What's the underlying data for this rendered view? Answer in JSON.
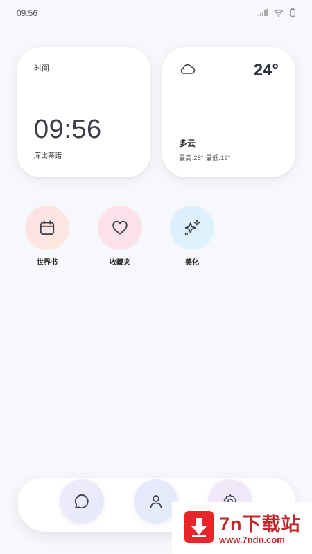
{
  "status_bar": {
    "time": "09:56",
    "icons": [
      "signal-icon",
      "wifi-icon",
      "battery-icon"
    ]
  },
  "time_widget": {
    "label": "时间",
    "time": "09:56",
    "subtitle": "库比蒂诺"
  },
  "weather_widget": {
    "icon": "cloud-icon",
    "temperature": "24°",
    "condition": "多云",
    "range": "最高:28° 最低:19°"
  },
  "apps": [
    {
      "label": "世界书",
      "icon": "calendar-icon",
      "color": "#fde0e6"
    },
    {
      "label": "收藏夹",
      "icon": "heart-icon",
      "color": "#fde1e7"
    },
    {
      "label": "美化",
      "icon": "sparkles-icon",
      "color": "#dcecff"
    }
  ],
  "dock": {
    "items": [
      {
        "icon": "chat-bubble-icon"
      },
      {
        "icon": "user-icon"
      },
      {
        "icon": "settings-icon"
      }
    ]
  },
  "watermark": {
    "title": "7n下载站",
    "url": "www.7ndn.com",
    "brand_color": "#e7262a"
  }
}
